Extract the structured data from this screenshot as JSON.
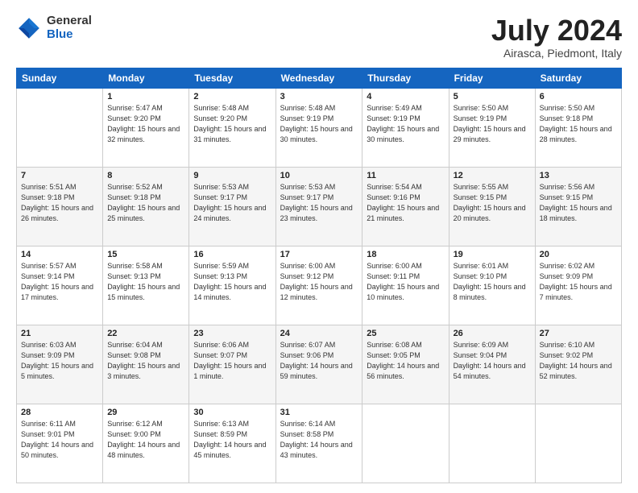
{
  "header": {
    "logo_general": "General",
    "logo_blue": "Blue",
    "title": "July 2024",
    "location": "Airasca, Piedmont, Italy"
  },
  "weekdays": [
    "Sunday",
    "Monday",
    "Tuesday",
    "Wednesday",
    "Thursday",
    "Friday",
    "Saturday"
  ],
  "weeks": [
    [
      {
        "day": "",
        "info": ""
      },
      {
        "day": "1",
        "info": "Sunrise: 5:47 AM\nSunset: 9:20 PM\nDaylight: 15 hours\nand 32 minutes."
      },
      {
        "day": "2",
        "info": "Sunrise: 5:48 AM\nSunset: 9:20 PM\nDaylight: 15 hours\nand 31 minutes."
      },
      {
        "day": "3",
        "info": "Sunrise: 5:48 AM\nSunset: 9:19 PM\nDaylight: 15 hours\nand 30 minutes."
      },
      {
        "day": "4",
        "info": "Sunrise: 5:49 AM\nSunset: 9:19 PM\nDaylight: 15 hours\nand 30 minutes."
      },
      {
        "day": "5",
        "info": "Sunrise: 5:50 AM\nSunset: 9:19 PM\nDaylight: 15 hours\nand 29 minutes."
      },
      {
        "day": "6",
        "info": "Sunrise: 5:50 AM\nSunset: 9:18 PM\nDaylight: 15 hours\nand 28 minutes."
      }
    ],
    [
      {
        "day": "7",
        "info": "Sunrise: 5:51 AM\nSunset: 9:18 PM\nDaylight: 15 hours\nand 26 minutes."
      },
      {
        "day": "8",
        "info": "Sunrise: 5:52 AM\nSunset: 9:18 PM\nDaylight: 15 hours\nand 25 minutes."
      },
      {
        "day": "9",
        "info": "Sunrise: 5:53 AM\nSunset: 9:17 PM\nDaylight: 15 hours\nand 24 minutes."
      },
      {
        "day": "10",
        "info": "Sunrise: 5:53 AM\nSunset: 9:17 PM\nDaylight: 15 hours\nand 23 minutes."
      },
      {
        "day": "11",
        "info": "Sunrise: 5:54 AM\nSunset: 9:16 PM\nDaylight: 15 hours\nand 21 minutes."
      },
      {
        "day": "12",
        "info": "Sunrise: 5:55 AM\nSunset: 9:15 PM\nDaylight: 15 hours\nand 20 minutes."
      },
      {
        "day": "13",
        "info": "Sunrise: 5:56 AM\nSunset: 9:15 PM\nDaylight: 15 hours\nand 18 minutes."
      }
    ],
    [
      {
        "day": "14",
        "info": "Sunrise: 5:57 AM\nSunset: 9:14 PM\nDaylight: 15 hours\nand 17 minutes."
      },
      {
        "day": "15",
        "info": "Sunrise: 5:58 AM\nSunset: 9:13 PM\nDaylight: 15 hours\nand 15 minutes."
      },
      {
        "day": "16",
        "info": "Sunrise: 5:59 AM\nSunset: 9:13 PM\nDaylight: 15 hours\nand 14 minutes."
      },
      {
        "day": "17",
        "info": "Sunrise: 6:00 AM\nSunset: 9:12 PM\nDaylight: 15 hours\nand 12 minutes."
      },
      {
        "day": "18",
        "info": "Sunrise: 6:00 AM\nSunset: 9:11 PM\nDaylight: 15 hours\nand 10 minutes."
      },
      {
        "day": "19",
        "info": "Sunrise: 6:01 AM\nSunset: 9:10 PM\nDaylight: 15 hours\nand 8 minutes."
      },
      {
        "day": "20",
        "info": "Sunrise: 6:02 AM\nSunset: 9:09 PM\nDaylight: 15 hours\nand 7 minutes."
      }
    ],
    [
      {
        "day": "21",
        "info": "Sunrise: 6:03 AM\nSunset: 9:09 PM\nDaylight: 15 hours\nand 5 minutes."
      },
      {
        "day": "22",
        "info": "Sunrise: 6:04 AM\nSunset: 9:08 PM\nDaylight: 15 hours\nand 3 minutes."
      },
      {
        "day": "23",
        "info": "Sunrise: 6:06 AM\nSunset: 9:07 PM\nDaylight: 15 hours\nand 1 minute."
      },
      {
        "day": "24",
        "info": "Sunrise: 6:07 AM\nSunset: 9:06 PM\nDaylight: 14 hours\nand 59 minutes."
      },
      {
        "day": "25",
        "info": "Sunrise: 6:08 AM\nSunset: 9:05 PM\nDaylight: 14 hours\nand 56 minutes."
      },
      {
        "day": "26",
        "info": "Sunrise: 6:09 AM\nSunset: 9:04 PM\nDaylight: 14 hours\nand 54 minutes."
      },
      {
        "day": "27",
        "info": "Sunrise: 6:10 AM\nSunset: 9:02 PM\nDaylight: 14 hours\nand 52 minutes."
      }
    ],
    [
      {
        "day": "28",
        "info": "Sunrise: 6:11 AM\nSunset: 9:01 PM\nDaylight: 14 hours\nand 50 minutes."
      },
      {
        "day": "29",
        "info": "Sunrise: 6:12 AM\nSunset: 9:00 PM\nDaylight: 14 hours\nand 48 minutes."
      },
      {
        "day": "30",
        "info": "Sunrise: 6:13 AM\nSunset: 8:59 PM\nDaylight: 14 hours\nand 45 minutes."
      },
      {
        "day": "31",
        "info": "Sunrise: 6:14 AM\nSunset: 8:58 PM\nDaylight: 14 hours\nand 43 minutes."
      },
      {
        "day": "",
        "info": ""
      },
      {
        "day": "",
        "info": ""
      },
      {
        "day": "",
        "info": ""
      }
    ]
  ]
}
